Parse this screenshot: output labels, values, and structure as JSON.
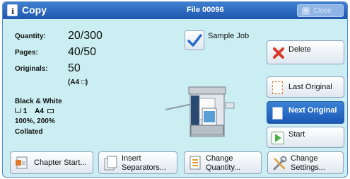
{
  "header": {
    "title": "Copy",
    "file": "File 00096",
    "close_label": "Close"
  },
  "job": {
    "quantity_label": "Quantity:",
    "quantity_value": "20/300",
    "pages_label": "Pages:",
    "pages_value": "40/50",
    "originals_label": "Originals:",
    "originals_value": "50",
    "paper_size": "(A4 □)"
  },
  "settings_summary": {
    "color": "Black & White",
    "tray": "1",
    "size": "A4",
    "reduction": "100%, 200%",
    "finishing": "Collated"
  },
  "sample_job": {
    "label": "Sample Job",
    "checked": true
  },
  "actions": {
    "delete": "Delete",
    "last_original": "Last Original",
    "next_original": "Next Original",
    "start": "Start"
  },
  "bottom_buttons": {
    "chapter_start": "Chapter Start...",
    "insert_line1": "Insert",
    "insert_line2": "Separators...",
    "change_qty_line1": "Change",
    "change_qty_line2": "Quantity...",
    "change_set_line1": "Change",
    "change_set_line2": "Settings..."
  },
  "colors": {
    "titlebar": "#2d69c2",
    "panel": "#cbeef2",
    "active_button": "#2a6cc6",
    "start_green": "#47b347",
    "delete_red": "#d83a2a"
  }
}
